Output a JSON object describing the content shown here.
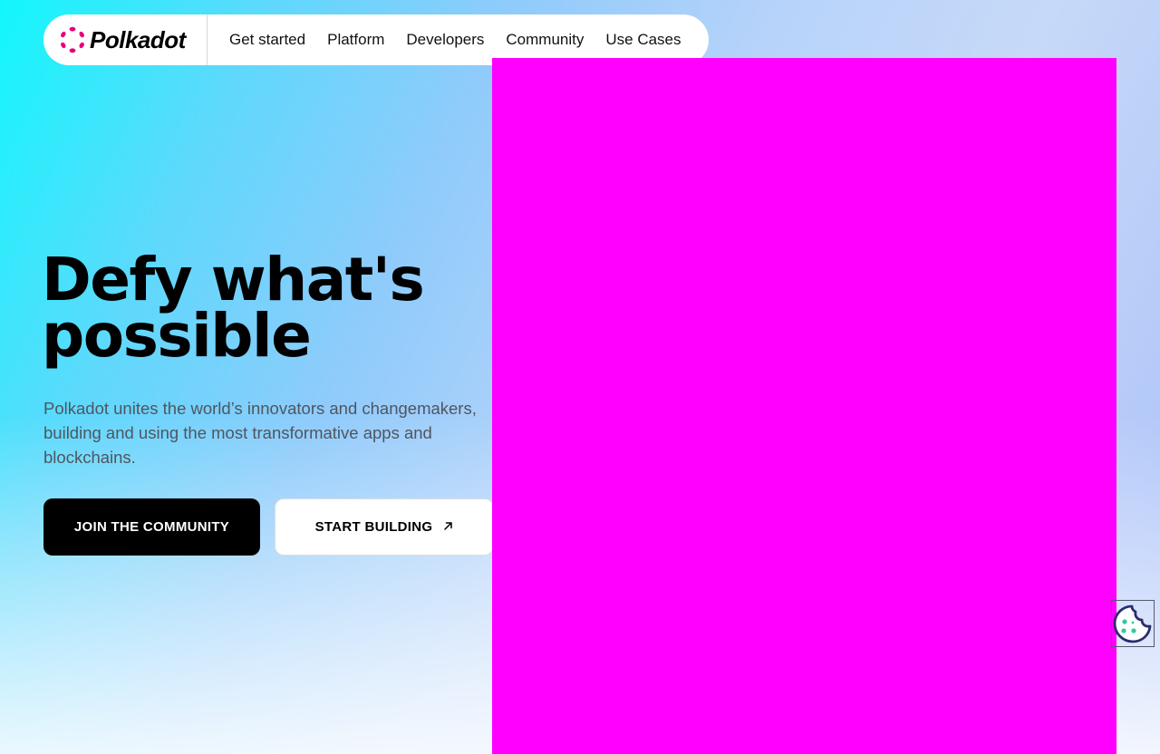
{
  "nav": {
    "brand": "Polkadot",
    "links": [
      "Get started",
      "Platform",
      "Developers",
      "Community",
      "Use Cases"
    ]
  },
  "hero": {
    "title": "Defy what's possible",
    "subtitle": "Polkadot unites the world’s innovators and changemakers, building and using the most transformative apps and blockchains.",
    "primary_button": "JOIN THE COMMUNITY",
    "secondary_button": "START BUILDING"
  },
  "colors": {
    "brand_pink": "#E6007A",
    "media_placeholder": "#FF00FF",
    "cookie_outline": "#2B2D6E",
    "cookie_dots": "#2ECC9A"
  },
  "icons": {
    "logo": "polkadot-logo-icon",
    "external_arrow": "arrow-up-right-icon",
    "cookie": "cookie-icon"
  }
}
